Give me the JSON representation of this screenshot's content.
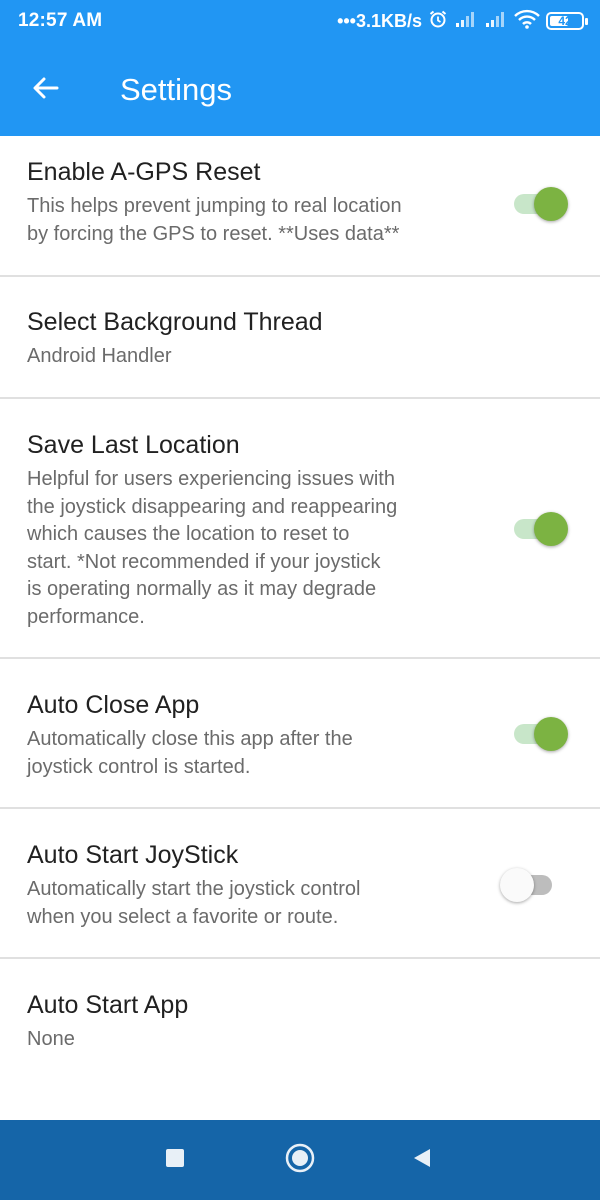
{
  "status_bar": {
    "time": "12:57 AM",
    "network_speed": "•••3.1KB/s",
    "battery": "42",
    "icons": [
      "alarm-icon",
      "signal-icon",
      "signal-icon",
      "wifi-icon",
      "battery-icon"
    ]
  },
  "app_bar": {
    "title": "Settings",
    "back_icon": "arrow-back-icon"
  },
  "preferences": [
    {
      "title": "Enable A-GPS Reset",
      "summary_lines": [
        "This helps prevent jumping to real location",
        "by forcing the GPS to reset. **Uses data**"
      ],
      "switch": "on"
    },
    {
      "title": "Select Background Thread",
      "summary_lines": [
        "Android Handler"
      ],
      "switch": null
    },
    {
      "title": "Save Last Location",
      "summary_lines": [
        "Helpful for users experiencing issues with",
        "the joystick disappearing and reappearing",
        "which causes the location to reset to",
        "start. *Not recommended if your joystick",
        "is operating normally as it may degrade",
        "performance."
      ],
      "switch": "on"
    },
    {
      "title": "Auto Close App",
      "summary_lines": [
        "Automatically close this app after the",
        "joystick control is started."
      ],
      "switch": "on"
    },
    {
      "title": "Auto Start JoyStick",
      "summary_lines": [
        "Automatically start the joystick control",
        "when you select a favorite or route."
      ],
      "switch": "off"
    },
    {
      "title": "Auto Start App",
      "summary_lines": [
        "None"
      ],
      "switch": null
    }
  ],
  "colors": {
    "primary": "#2196F3",
    "nav_bar": "#1565a8",
    "switch_on": "#7cb342",
    "switch_on_track": "#c8e6c9",
    "switch_off_track": "#bdbdbd",
    "category_accent": "#8bc34a"
  },
  "nav_bar": {
    "buttons": [
      "recents-square-icon",
      "home-circle-icon",
      "back-triangle-icon"
    ]
  }
}
